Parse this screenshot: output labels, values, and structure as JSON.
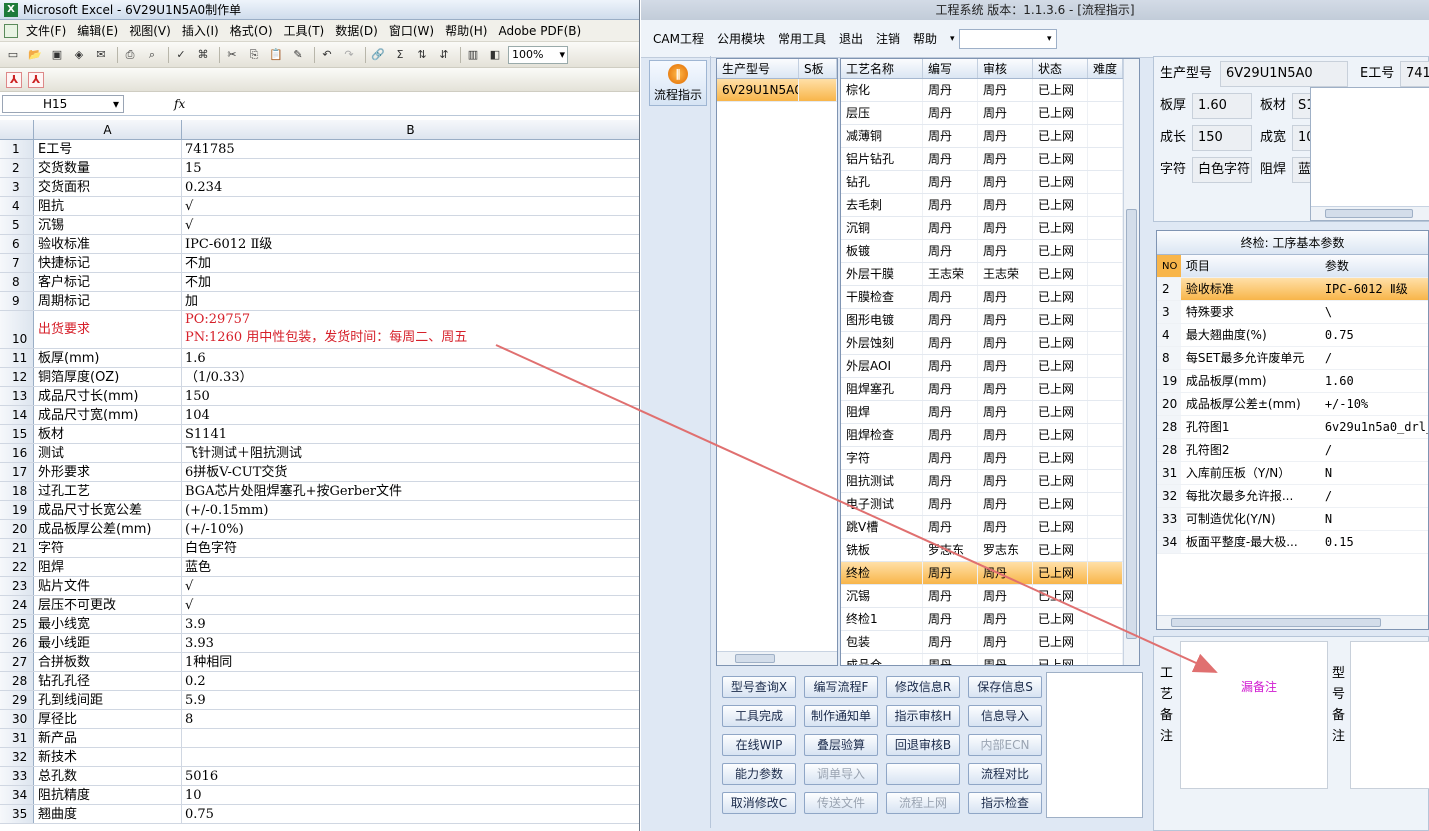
{
  "excel": {
    "title": "Microsoft Excel - 6V29U1N5A0制作单",
    "menu": [
      "文件(F)",
      "编辑(E)",
      "视图(V)",
      "插入(I)",
      "格式(O)",
      "工具(T)",
      "数据(D)",
      "窗口(W)",
      "帮助(H)",
      "Adobe PDF(B)"
    ],
    "zoom": "100%",
    "name_box": "H15",
    "fx": "fx",
    "col_headers": [
      "A",
      "B"
    ],
    "rows": [
      {
        "n": "1",
        "a": "E工号",
        "b": "741785"
      },
      {
        "n": "2",
        "a": "交货数量",
        "b": "15"
      },
      {
        "n": "3",
        "a": "交货面积",
        "b": "0.234"
      },
      {
        "n": "4",
        "a": "阻抗",
        "b": "√"
      },
      {
        "n": "5",
        "a": "沉锡",
        "b": "√"
      },
      {
        "n": "6",
        "a": "验收标准",
        "b": "IPC-6012 Ⅱ级"
      },
      {
        "n": "7",
        "a": "快捷标记",
        "b": "不加"
      },
      {
        "n": "8",
        "a": "客户标记",
        "b": "不加"
      },
      {
        "n": "9",
        "a": "周期标记",
        "b": "加"
      },
      {
        "n": "10",
        "a": "出货要求",
        "b": "PO:29757",
        "b2": "PN:1260 用中性包装，发货时间：每周二、周五"
      },
      {
        "n": "11",
        "a": "板厚(mm)",
        "b": "1.6"
      },
      {
        "n": "12",
        "a": "铜箔厚度(OZ)",
        "b": "（1/0.33）"
      },
      {
        "n": "13",
        "a": "成品尺寸长(mm)",
        "b": "150"
      },
      {
        "n": "14",
        "a": "成品尺寸宽(mm)",
        "b": "104"
      },
      {
        "n": "15",
        "a": "板材",
        "b": "S1141"
      },
      {
        "n": "16",
        "a": "测试",
        "b": "飞针测试＋阻抗测试"
      },
      {
        "n": "17",
        "a": "外形要求",
        "b": "6拼板V-CUT交货"
      },
      {
        "n": "18",
        "a": "过孔工艺",
        "b": "BGA芯片处阻焊塞孔+按Gerber文件"
      },
      {
        "n": "19",
        "a": "成品尺寸长宽公差",
        "b": "(+/-0.15mm)"
      },
      {
        "n": "20",
        "a": "成品板厚公差(mm)",
        "b": "(+/-10%)"
      },
      {
        "n": "21",
        "a": "字符",
        "b": "白色字符"
      },
      {
        "n": "22",
        "a": "阻焊",
        "b": "蓝色"
      },
      {
        "n": "23",
        "a": "贴片文件",
        "b": "√"
      },
      {
        "n": "24",
        "a": "层压不可更改",
        "b": "√"
      },
      {
        "n": "25",
        "a": "最小线宽",
        "b": "3.9"
      },
      {
        "n": "26",
        "a": "最小线距",
        "b": "3.93"
      },
      {
        "n": "27",
        "a": "合拼板数",
        "b": "1种相同"
      },
      {
        "n": "28",
        "a": "钻孔孔径",
        "b": "0.2"
      },
      {
        "n": "29",
        "a": "孔到线间距",
        "b": "5.9"
      },
      {
        "n": "30",
        "a": "厚径比",
        "b": "8"
      },
      {
        "n": "31",
        "a": "新产品",
        "b": ""
      },
      {
        "n": "32",
        "a": "新技术",
        "b": ""
      },
      {
        "n": "33",
        "a": "总孔数",
        "b": "5016"
      },
      {
        "n": "34",
        "a": "阻抗精度",
        "b": "10"
      },
      {
        "n": "35",
        "a": "翘曲度",
        "b": "0.75"
      }
    ]
  },
  "cam": {
    "title": "工程系统    版本：1.1.3.6 - [流程指示]",
    "menu": [
      "CAM工程",
      "公用模块",
      "常用工具",
      "退出",
      "注销",
      "帮助"
    ],
    "side_button": "流程指示",
    "model_list": {
      "headers": [
        "生产型号",
        "S板"
      ],
      "rows": [
        [
          "6V29U1N5A0",
          ""
        ]
      ]
    },
    "process_grid": {
      "headers": [
        "工艺名称",
        "编写",
        "审核",
        "状态",
        "难度"
      ],
      "rows": [
        [
          "棕化",
          "周丹",
          "周丹",
          "已上网",
          ""
        ],
        [
          "层压",
          "周丹",
          "周丹",
          "已上网",
          ""
        ],
        [
          "减薄铜",
          "周丹",
          "周丹",
          "已上网",
          ""
        ],
        [
          "铝片钻孔",
          "周丹",
          "周丹",
          "已上网",
          ""
        ],
        [
          "钻孔",
          "周丹",
          "周丹",
          "已上网",
          ""
        ],
        [
          "去毛刺",
          "周丹",
          "周丹",
          "已上网",
          ""
        ],
        [
          "沉铜",
          "周丹",
          "周丹",
          "已上网",
          ""
        ],
        [
          "板镀",
          "周丹",
          "周丹",
          "已上网",
          ""
        ],
        [
          "外层干膜",
          "王志荣",
          "王志荣",
          "已上网",
          ""
        ],
        [
          "干膜检查",
          "周丹",
          "周丹",
          "已上网",
          ""
        ],
        [
          "图形电镀",
          "周丹",
          "周丹",
          "已上网",
          ""
        ],
        [
          "外层蚀刻",
          "周丹",
          "周丹",
          "已上网",
          ""
        ],
        [
          "外层AOI",
          "周丹",
          "周丹",
          "已上网",
          ""
        ],
        [
          "阻焊塞孔",
          "周丹",
          "周丹",
          "已上网",
          ""
        ],
        [
          "阻焊",
          "周丹",
          "周丹",
          "已上网",
          ""
        ],
        [
          "阻焊检查",
          "周丹",
          "周丹",
          "已上网",
          ""
        ],
        [
          "字符",
          "周丹",
          "周丹",
          "已上网",
          ""
        ],
        [
          "阻抗测试",
          "周丹",
          "周丹",
          "已上网",
          ""
        ],
        [
          "电子测试",
          "周丹",
          "周丹",
          "已上网",
          ""
        ],
        [
          "跳V槽",
          "周丹",
          "周丹",
          "已上网",
          ""
        ],
        [
          "铣板",
          "罗志东",
          "罗志东",
          "已上网",
          ""
        ],
        [
          "终检",
          "周丹",
          "周丹",
          "已上网",
          ""
        ],
        [
          "沉锡",
          "周丹",
          "周丹",
          "已上网",
          ""
        ],
        [
          "终检1",
          "周丹",
          "周丹",
          "已上网",
          ""
        ],
        [
          "包装",
          "周丹",
          "周丹",
          "已上网",
          ""
        ],
        [
          "成品仓",
          "周丹",
          "周丹",
          "已上网",
          ""
        ]
      ],
      "selected_index": 21
    },
    "buttons": [
      [
        "型号查询X",
        "编写流程F",
        "修改信息R",
        "保存信息S"
      ],
      [
        "工具完成",
        "制作通知单",
        "指示审核H",
        "信息导入"
      ],
      [
        "在线WIP",
        "叠层验算",
        "回退审核B",
        "内部ECN"
      ],
      [
        "能力参数",
        "调单导入",
        "",
        "流程对比"
      ],
      [
        "取消修改C",
        "传送文件",
        "流程上网",
        "指示检查"
      ]
    ],
    "disabled_buttons": [
      "内部ECN",
      "调单导入",
      "传送文件",
      "流程上网"
    ],
    "info": {
      "model_label": "生产型号",
      "model_value": "6V29U1N5A0",
      "e_label": "E工号",
      "e_value": "741",
      "thick_label": "板厚",
      "thick_value": "1.60",
      "mat_label": "板材",
      "mat_value": "S1",
      "len_label": "成长",
      "len_value": "150",
      "wid_label": "成宽",
      "wid_value": "10",
      "char_label": "字符",
      "char_value": "白色字符",
      "mask_label": "阻焊",
      "mask_value": "蓝"
    },
    "params": {
      "title": "终检: 工序基本参数",
      "headers": [
        "NO",
        "项目",
        "参数"
      ],
      "rows": [
        [
          "2",
          "验收标准",
          "IPC-6012 Ⅱ级"
        ],
        [
          "3",
          "特殊要求",
          "\\"
        ],
        [
          "4",
          "最大翘曲度(%)",
          "0.75"
        ],
        [
          "8",
          "每SET最多允许废单元",
          "/"
        ],
        [
          "19",
          "成品板厚(mm)",
          "1.60"
        ],
        [
          "20",
          "成品板厚公差±(mm)",
          "+/-10%"
        ],
        [
          "28",
          "孔符图1",
          "6v29u1n5a0_drl_"
        ],
        [
          "28",
          "孔符图2",
          "/"
        ],
        [
          "31",
          "入库前压板（Y/N）",
          "N"
        ],
        [
          "32",
          "每批次最多允许报...",
          "/"
        ],
        [
          "33",
          "可制造优化(Y/N)",
          "N"
        ],
        [
          "34",
          "板面平整度-最大极...",
          "0.15"
        ]
      ],
      "selected_index": 0
    },
    "process_note_label": "工艺备注",
    "process_note_text": "漏备注",
    "model_note_label": "型号备注",
    "accent": "#f8b54a",
    "annotation_color": "#e07070"
  }
}
